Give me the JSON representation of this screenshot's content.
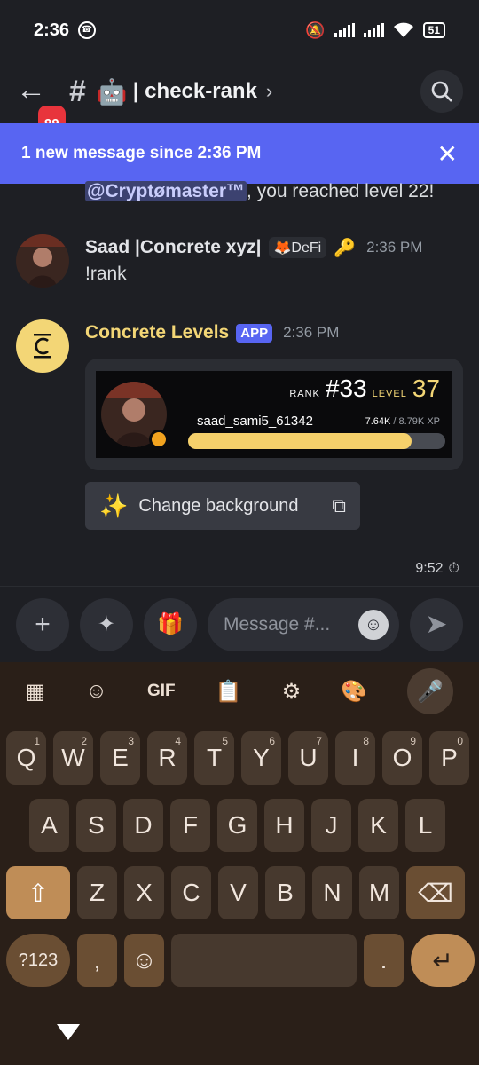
{
  "status_bar": {
    "time": "2:36",
    "battery": "51"
  },
  "header": {
    "notification_count": "99",
    "channel_emoji": "🤖",
    "channel_name": "| check-rank"
  },
  "banner": {
    "text": "1 new message since 2:36 PM"
  },
  "partial_message": {
    "mention": "@Cryptømaster™",
    "text": ", you reached level 22!"
  },
  "messages": [
    {
      "username": "Saad |Concrete xyz|",
      "role_tag": "DeFi",
      "timestamp": "2:36 PM",
      "text": "!rank"
    },
    {
      "username": "Concrete Levels",
      "badge": "APP",
      "timestamp": "2:36 PM"
    }
  ],
  "rank_card": {
    "rank_label": "RANK",
    "rank": "#33",
    "level_label": "LEVEL",
    "level": "37",
    "username": "saad_sami5_61342",
    "xp_current": "7.64K",
    "xp_total": "/ 8.79K XP",
    "progress": 0.87
  },
  "change_background_button": {
    "label": "Change background"
  },
  "footer_time": "9:52",
  "composer": {
    "placeholder": "Message #..."
  },
  "keyboard": {
    "tools": [
      "apps-icon",
      "sticker-icon",
      "GIF",
      "clipboard-icon",
      "settings-icon",
      "palette-icon",
      "mic-icon"
    ],
    "gif_label": "GIF",
    "row1": [
      "Q",
      "W",
      "E",
      "R",
      "T",
      "Y",
      "U",
      "I",
      "O",
      "P"
    ],
    "row1_nums": [
      "1",
      "2",
      "3",
      "4",
      "5",
      "6",
      "7",
      "8",
      "9",
      "0"
    ],
    "row2": [
      "A",
      "S",
      "D",
      "F",
      "G",
      "H",
      "J",
      "K",
      "L"
    ],
    "row3": [
      "Z",
      "X",
      "C",
      "V",
      "B",
      "N",
      "M"
    ],
    "symbols_label": "?123",
    "comma": ",",
    "period": "."
  },
  "colors": {
    "accent": "#5865f2",
    "app_name": "#f3d676",
    "progress_fill": "#f5d06b",
    "keyboard_bg": "#2a1f18"
  }
}
